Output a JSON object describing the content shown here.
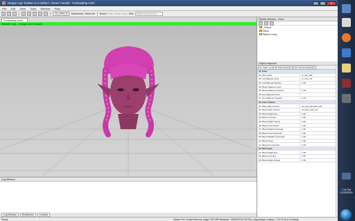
{
  "window": {
    "title": "Dragon Age Toolset v1.0.1008.0 - Demo Tutorial - Fucheadmp.mmh",
    "buttons": [
      "–",
      "□",
      "✕"
    ]
  },
  "menu": [
    "File",
    "Edit",
    "View",
    "Tools",
    "Window",
    "Help"
  ],
  "toolbar": {
    "mesh_dropdown": "XN_DHM_B",
    "labels": [
      "Randomize",
      "Reset All",
      "Bones",
      "Play",
      "Show",
      "Stop",
      "XML"
    ],
    "search_placeholder": "Batch export visual"
  },
  "document": {
    "tab_label": "Fucheadmp.mmh",
    "status_message": "Writable Copy - Changes can be saved."
  },
  "log": {
    "title": "Log Window",
    "tabs": [
      "Log Window",
      "Bookmarks",
      "Console"
    ]
  },
  "statusbar": {
    "left": "Ready",
    "right": "Mouse Pos:  Toolset Memory Usage: 870 MB  Database: .\\MSDATOOLSET\\fav_diagnosage_custom_1  2.9.12.dv  8  1s  Ready"
  },
  "palette": {
    "title": "Palette Window - Zone",
    "items": [
      "_Global",
      "Demo",
      "Writer's comp"
    ]
  },
  "inspector": {
    "title": "Object Inspector",
    "tabs": [
      "01. Make-up",
      "02. Part selection",
      "03. Texture Selection"
    ],
    "sections": [
      {
        "name": "01. Face",
        "rows": [
          {
            "name": "01. Skin Color",
            "value": "rs_skn_011"
          },
          {
            "name": "02. Lip Makeup Color",
            "value": "t1_mcl_ro1"
          },
          {
            "name": "03. Lip Makeup Opacity",
            "value": "1.00"
          },
          {
            "name": "04. Blush Makeup Color",
            "value": ""
          },
          {
            "name": "05. Blush Makeup Opacity",
            "value": "1.00"
          },
          {
            "name": "06. Eye Makeup Color",
            "value": ""
          },
          {
            "name": "07. Eye Makeup Opacity",
            "value": "1.00"
          }
        ]
      },
      {
        "name": "02. Face Texture",
        "rows": [
          {
            "name": "01. Base Skin Texture",
            "value": "uh_hed_tbrowfe1_0d"
          },
          {
            "name": "02. Blend Skin Texture",
            "value": "uh_hed_exfe_0d"
          },
          {
            "name": "03. Blend Right Eye",
            "value": "1.00"
          },
          {
            "name": "04. Blend Left Eye",
            "value": "1.00"
          },
          {
            "name": "05. Blend Right Cheek",
            "value": "1.00"
          },
          {
            "name": "06. Blend Left Cheek",
            "value": "1.00"
          },
          {
            "name": "07. Blend Right Forehead",
            "value": "1.00"
          },
          {
            "name": "08. Blend Left Forehead",
            "value": "1.00"
          },
          {
            "name": "09. Blend Middle Forehead",
            "value": "1.00"
          },
          {
            "name": "10. Blend Nose",
            "value": "1.00"
          },
          {
            "name": "11. Blend Art Override",
            "value": "1.00"
          }
        ]
      },
      {
        "name": "03. Skin Type",
        "rows": [
          {
            "name": "01. Blend Right Eye",
            "value": "1.00"
          },
          {
            "name": "02. Blend Left Eye",
            "value": "1.00"
          },
          {
            "name": "03. Blend Right Cheek",
            "value": "1.00"
          }
        ]
      }
    ]
  },
  "taskbar": {
    "time": "7:16 PM",
    "date": "12/15/2009"
  }
}
